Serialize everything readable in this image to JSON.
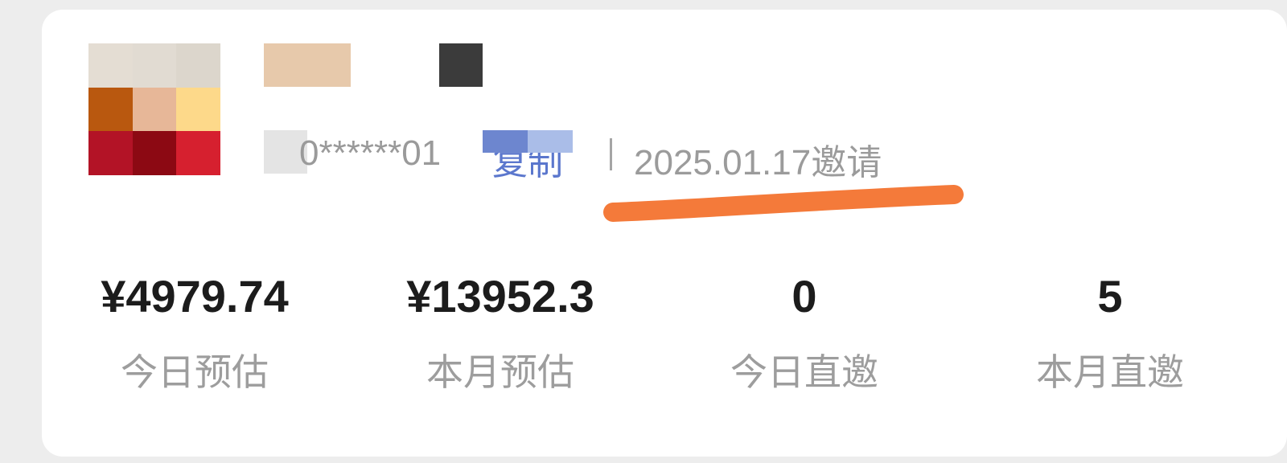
{
  "profile": {
    "avatar_colors": [
      "#e4ddd3",
      "#e1dbd2",
      "#dcd6cc",
      "#b9580f",
      "#e7b798",
      "#fdd98a",
      "#b31326",
      "#8c0913",
      "#d6202f"
    ],
    "name_mosaic_color": "#e7c9ab",
    "badge_mosaic_color": "#3b3b3b",
    "id_masked": "0******01",
    "copy_label": "复制",
    "separator": "|",
    "invite_text": "2025.01.17邀请"
  },
  "annotation": {
    "underline_color": "#f47a3a"
  },
  "stats": [
    {
      "value": "¥4979.74",
      "label": "今日预估"
    },
    {
      "value": "¥13952.3",
      "label": "本月预估"
    },
    {
      "value": "0",
      "label": "今日直邀"
    },
    {
      "value": "5",
      "label": "本月直邀"
    }
  ]
}
